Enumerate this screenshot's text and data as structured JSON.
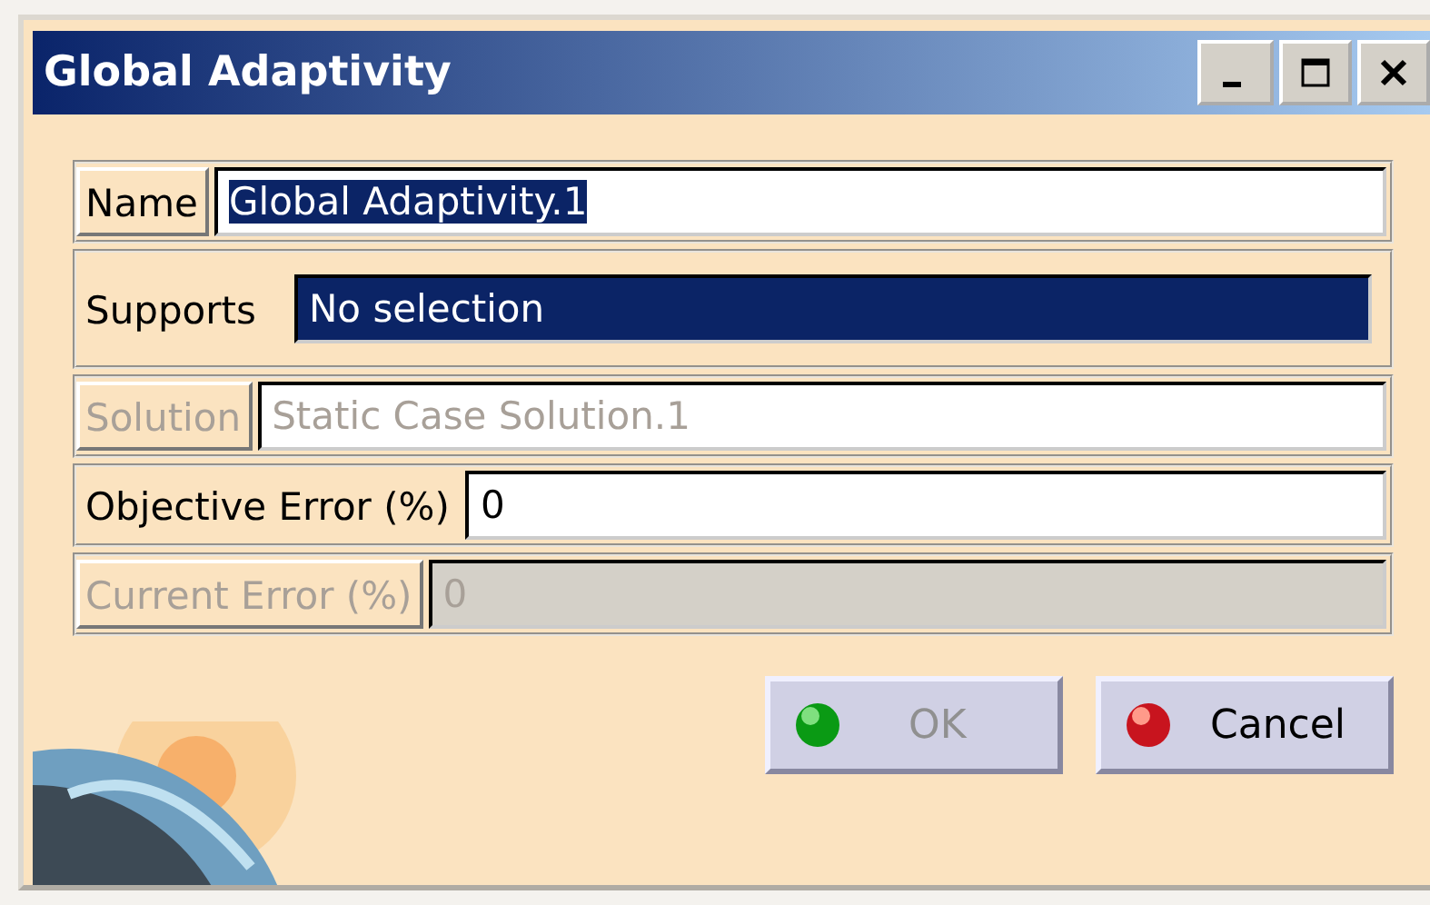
{
  "window": {
    "title": "Global Adaptivity"
  },
  "fields": [
    {
      "label": "Name",
      "value": "Global Adaptivity.1",
      "kind": "text",
      "framed": true,
      "disabled": false,
      "highlighted": true
    },
    {
      "label": "Supports",
      "value": "No selection",
      "kind": "selector",
      "framed": false,
      "disabled": false,
      "highlighted": true
    },
    {
      "label": "Solution",
      "value": "Static Case Solution.1",
      "kind": "text",
      "framed": true,
      "disabled": true,
      "highlighted": false
    },
    {
      "label": "Objective Error (%)",
      "value": "0",
      "kind": "text",
      "framed": false,
      "disabled": false,
      "highlighted": false
    },
    {
      "label": "Current Error (%)",
      "value": "0",
      "kind": "readonly",
      "framed": true,
      "disabled": true,
      "highlighted": false
    }
  ],
  "buttons": [
    {
      "label": "OK",
      "kind": "ok",
      "disabled": true
    },
    {
      "label": "Cancel",
      "kind": "cancel",
      "disabled": false
    }
  ]
}
